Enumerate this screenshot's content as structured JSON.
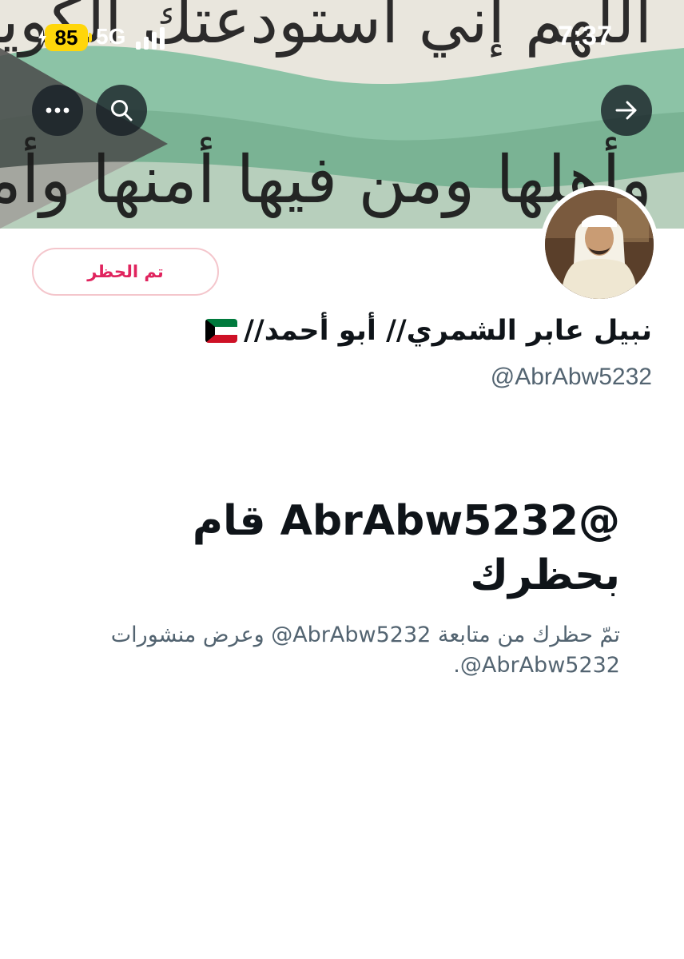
{
  "status_bar": {
    "battery": "85",
    "network": "5G",
    "time": "7:37"
  },
  "banner": {
    "line1": "اللهم إني أستودعتك الكويت",
    "line2": "وأهلها ومن فيها أمنها وأمانها",
    "colors": {
      "green": "#7fb79a",
      "dark": "#3a3a3a",
      "paper": "#e9e6dd"
    }
  },
  "nav": {
    "more_icon": "more-icon",
    "search_icon": "search-icon",
    "forward_icon": "arrow-right-icon"
  },
  "profile": {
    "blocked_label": "تم الحظر",
    "display_name": "نبيل عابر الشمري// أبو أحمد//",
    "flag_icon": "kuwait-flag-icon",
    "handle": "@AbrAbw5232"
  },
  "blocked_notice": {
    "title": "‏@AbrAbw5232 قام بحظرك",
    "description": "تمّ حظرك من متابعة ‎@AbrAbw5232 وعرض منشورات ‎@AbrAbw5232."
  },
  "colors": {
    "blocked_red": "#e0245e",
    "text_primary": "#0f1419",
    "text_secondary": "#536471",
    "battery_yellow": "#ffd60a"
  }
}
